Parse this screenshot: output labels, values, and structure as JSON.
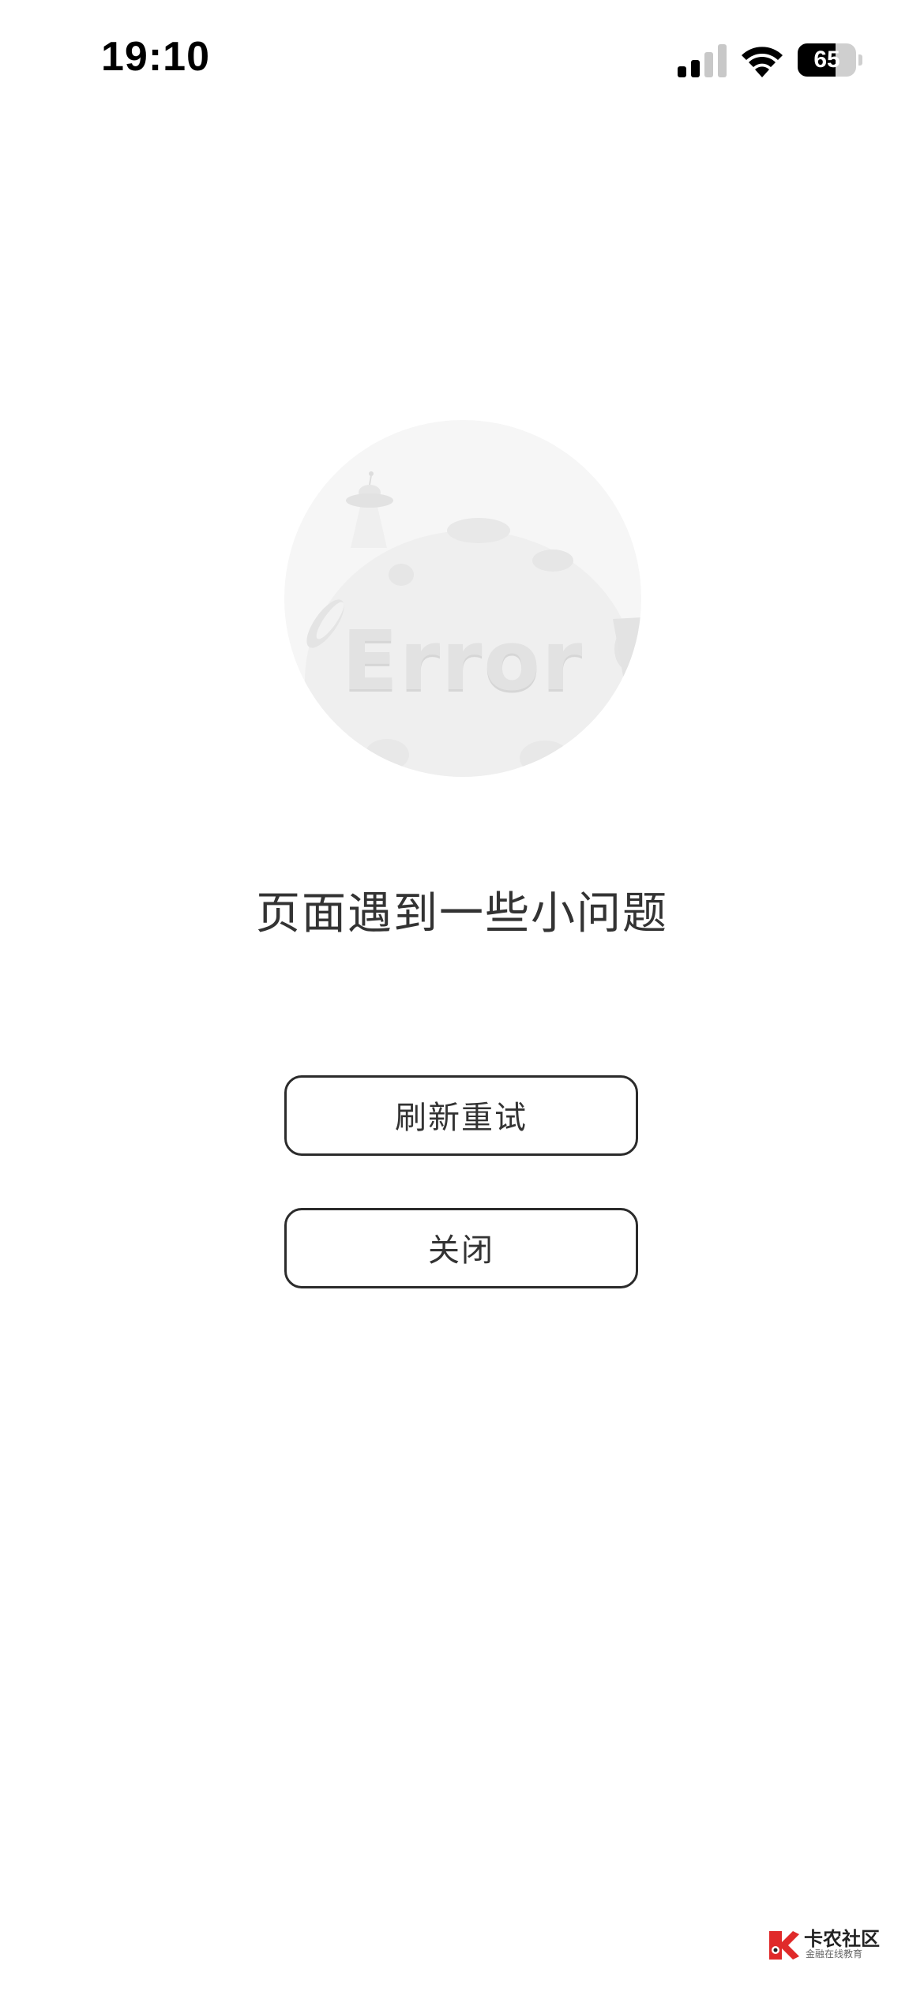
{
  "status_bar": {
    "time": "19:10",
    "battery_level": "65",
    "battery_fraction": 0.65,
    "icons": [
      "signal-icon",
      "wifi-icon",
      "battery-icon"
    ]
  },
  "illustration": {
    "word": "Error",
    "icons": [
      "planet-icon",
      "ufo-icon",
      "coin-icon"
    ]
  },
  "message": "页面遇到一些小问题",
  "buttons": {
    "refresh": "刷新重试",
    "close": "关闭"
  },
  "watermark": {
    "name": "卡农社区",
    "subtitle": "金融在线教育"
  },
  "colors": {
    "text": "#333333",
    "button_border": "#2b2b2b",
    "background": "#ffffff",
    "illustration": "#f3f3f3",
    "watermark_red": "#e02a2a"
  }
}
